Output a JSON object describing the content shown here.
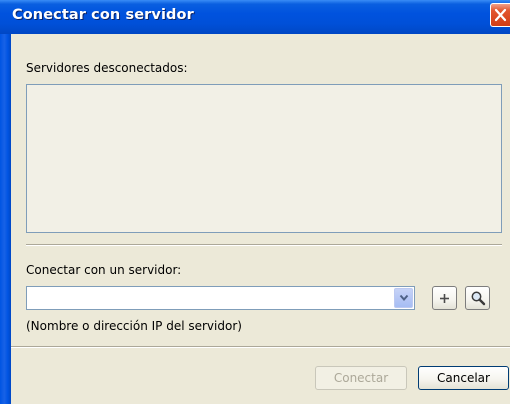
{
  "window": {
    "title": "Conectar con servidor",
    "close_icon": "close-icon"
  },
  "servers": {
    "heading": "Servidores desconectados:",
    "items": []
  },
  "connect": {
    "heading": "Conectar con un servidor:",
    "input_value": "",
    "hint": "(Nombre o dirección IP del servidor)",
    "dropdown_icon": "chevron-down-icon",
    "add_icon": "plus-icon",
    "search_icon": "magnifier-icon"
  },
  "footer": {
    "connect_label": "Conectar",
    "cancel_label": "Cancelar"
  },
  "colors": {
    "titlebar": "#0054e3",
    "dialog_bg": "#ece9d8",
    "close_red": "#e2562f"
  }
}
